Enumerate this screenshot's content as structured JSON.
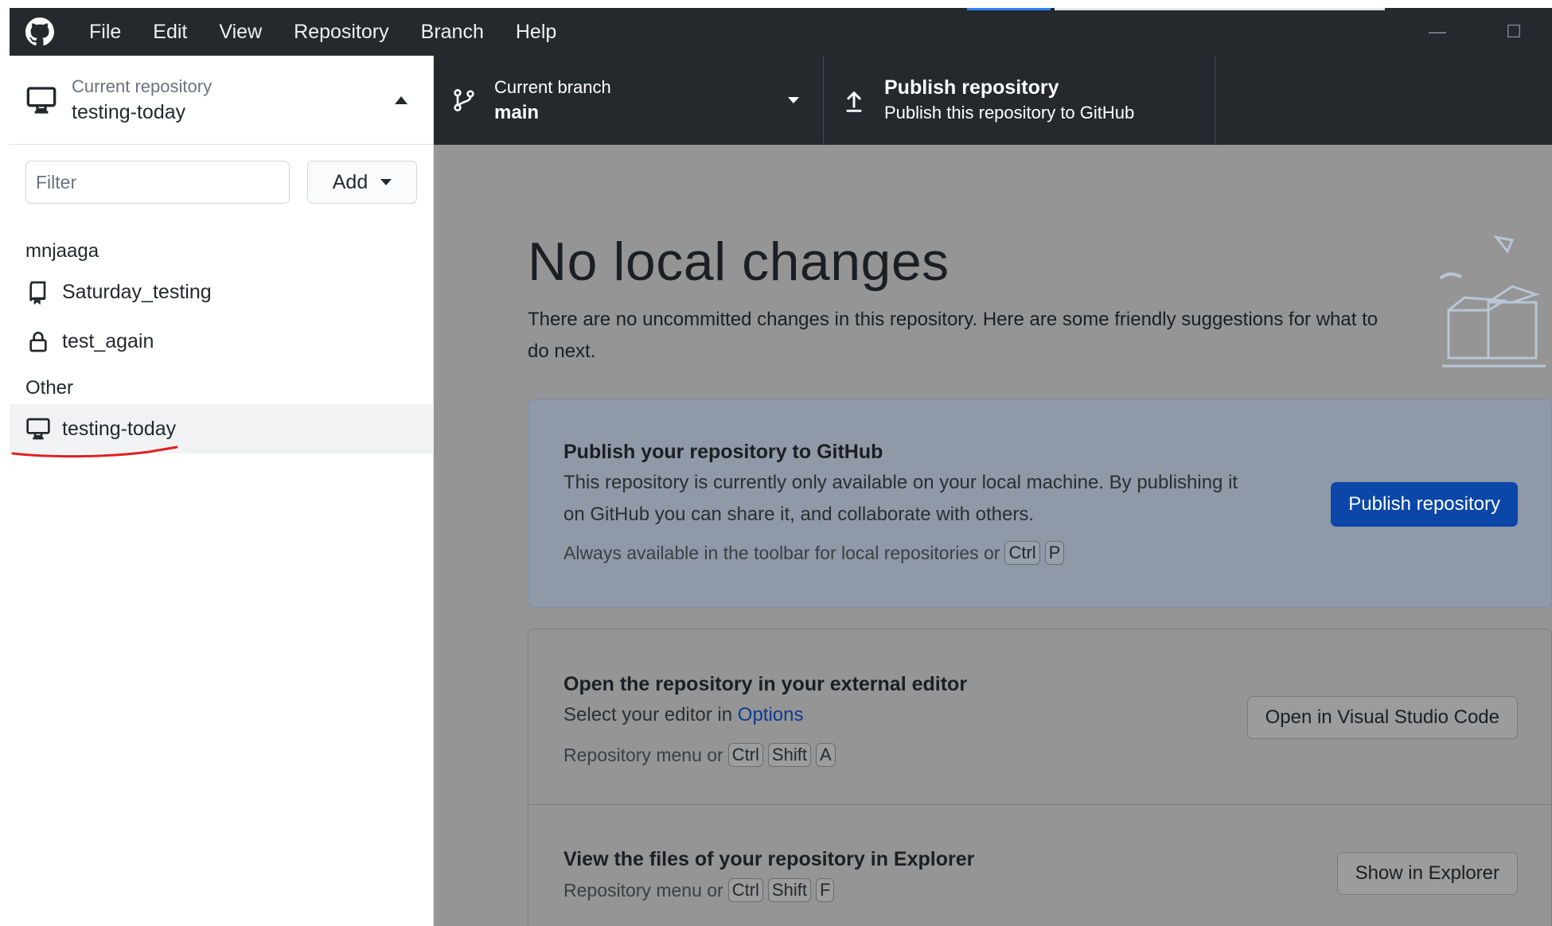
{
  "menu": {
    "items": [
      "File",
      "Edit",
      "View",
      "Repository",
      "Branch",
      "Help"
    ]
  },
  "window": {
    "minimize_glyph": "—",
    "maximize_glyph": "☐"
  },
  "repo_selector": {
    "label": "Current repository",
    "name": "testing-today"
  },
  "sidebar": {
    "filter_placeholder": "Filter",
    "add_label": "Add",
    "groups": [
      {
        "header": "mnjaaga",
        "items": [
          "Saturday_testing",
          "test_again"
        ]
      },
      {
        "header": "Other",
        "items": [
          "testing-today"
        ]
      }
    ]
  },
  "toolbar": {
    "branch_label": "Current branch",
    "branch_name": "main",
    "publish_title": "Publish repository",
    "publish_subtitle": "Publish this repository to GitHub"
  },
  "main": {
    "headline": "No local changes",
    "subtext": "There are no uncommitted changes in this repository. Here are some friendly suggestions for what to do next.",
    "cards": [
      {
        "title": "Publish your repository to GitHub",
        "description": "This repository is currently only available on your local machine. By publishing it on GitHub you can share it, and collaborate with others.",
        "hint": "Always available in the toolbar for local repositories or",
        "keys": [
          "Ctrl",
          "P"
        ],
        "button": "Publish repository"
      },
      {
        "title": "Open the repository in your external editor",
        "description_prefix": "Select your editor in",
        "description_link": "Options",
        "hint": "Repository menu or",
        "keys": [
          "Ctrl",
          "Shift",
          "A"
        ],
        "button": "Open in Visual Studio Code"
      },
      {
        "title": "View the files of your repository in Explorer",
        "hint": "Repository menu or",
        "keys": [
          "Ctrl",
          "Shift",
          "F"
        ],
        "button": "Show in Explorer"
      }
    ]
  },
  "colors": {
    "titlebar": "#24292e",
    "main_bg": "#959595",
    "primary_button": "#0a47a8",
    "annotation_underline": "#e02020"
  }
}
